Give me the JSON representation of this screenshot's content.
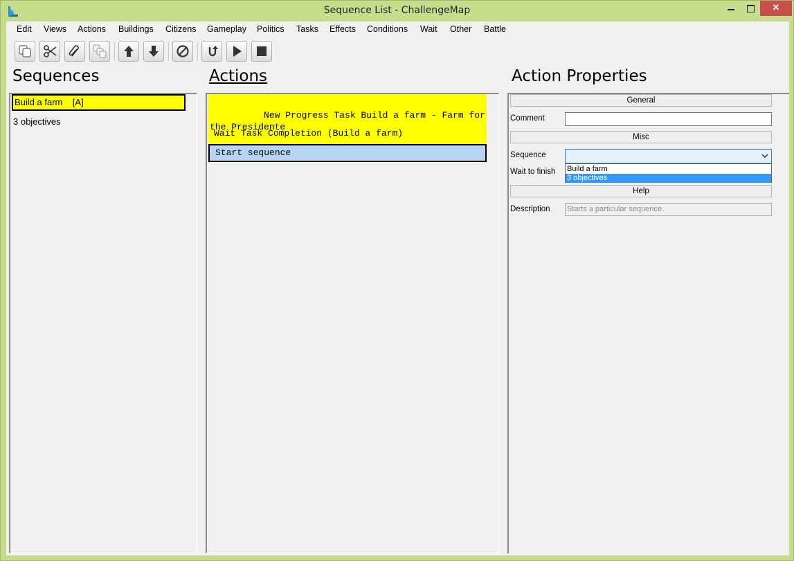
{
  "window": {
    "title": "Sequence List - ChallengeMap",
    "close_color": "#c7504b",
    "frame_color": "#c6dd8b"
  },
  "menu": [
    "Edit",
    "Views",
    "Actions",
    "Buildings",
    "Citizens",
    "Gameplay",
    "Politics",
    "Tasks",
    "Effects",
    "Conditions",
    "Wait",
    "Other",
    "Battle"
  ],
  "toolbar": {
    "buttons": [
      "copy-icon",
      "cut-icon",
      "paste-icon",
      "duplicate-icon",
      "move-up-icon",
      "move-down-icon",
      "disable-icon",
      "reset-icon",
      "play-icon",
      "stop-icon"
    ]
  },
  "sequences": {
    "heading": "Sequences",
    "items": [
      {
        "label": "Build a farm    [A]",
        "selected": true
      },
      {
        "label": "3 objectives",
        "selected": false
      }
    ]
  },
  "actions": {
    "heading": "Actions",
    "items": [
      {
        "label": "  New Progress Task Build a farm - Farm for the Presidente",
        "style": "highlight"
      },
      {
        "label": "Wait Task Completion (Build a farm)",
        "style": "plain"
      },
      {
        "label": "Start sequence",
        "style": "selected"
      }
    ]
  },
  "properties": {
    "heading": "Action Properties",
    "general": "General",
    "comment_label": "Comment",
    "comment_value": "",
    "misc": "Misc",
    "sequence_label": "Sequence",
    "sequence_value": "",
    "wait_label": "Wait to finish",
    "dropdown_options": [
      "Build a farm",
      "3 objectives"
    ],
    "dropdown_highlight": "3 objectives",
    "help": "Help",
    "description_label": "Description",
    "description_value": "Starts a particular sequence."
  }
}
